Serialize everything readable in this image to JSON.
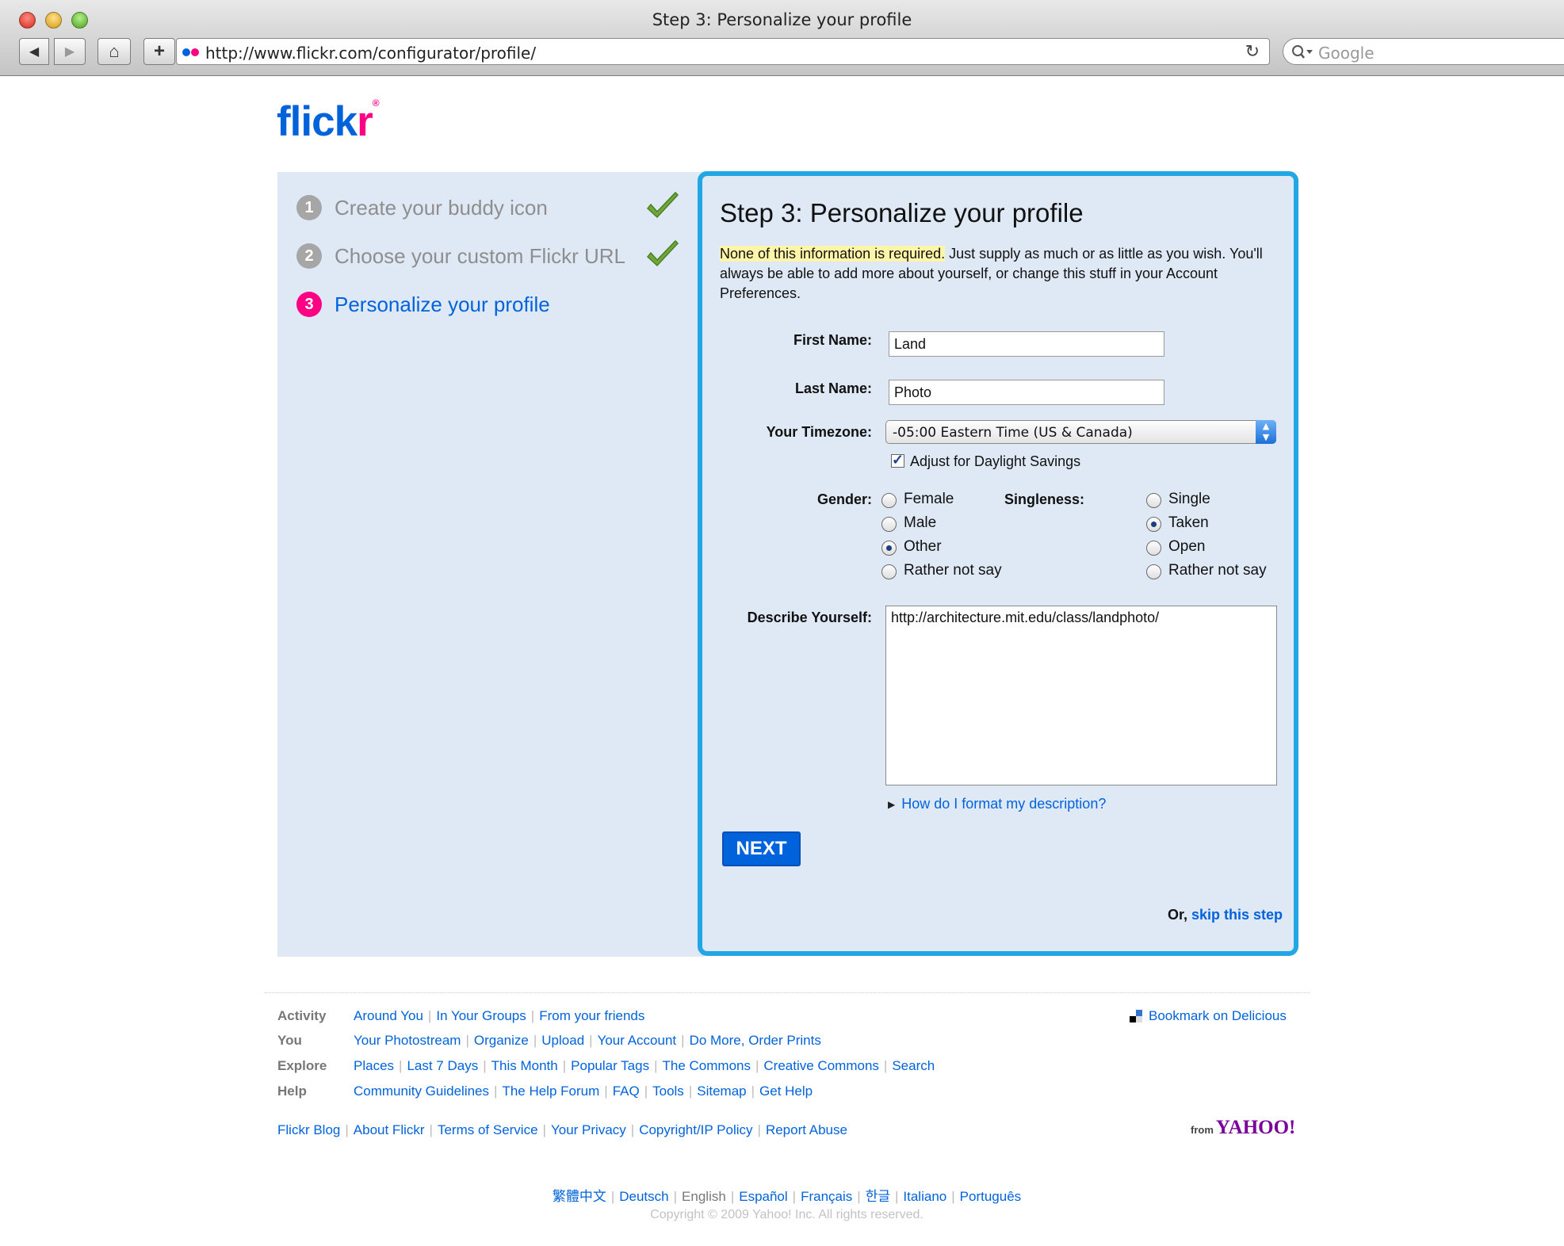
{
  "window": {
    "title": "Step 3: Personalize your profile"
  },
  "toolbar": {
    "url": "http://www.flickr.com/configurator/profile/",
    "search_placeholder": "Google"
  },
  "logo": {
    "text_main": "flick",
    "text_r": "r"
  },
  "steps": [
    {
      "num": "1",
      "label": "Create your buddy icon",
      "done": true
    },
    {
      "num": "2",
      "label": "Choose your custom Flickr URL",
      "done": true
    },
    {
      "num": "3",
      "label": "Personalize your profile",
      "done": false
    }
  ],
  "form": {
    "title": "Step 3: Personalize your profile",
    "intro_highlight": "None of this information is required.",
    "intro_rest": " Just supply as much or as little as you wish. You'll always be able to add more about yourself, or change this stuff in your Account Preferences.",
    "first_name_label": "First Name:",
    "first_name_value": "Land",
    "last_name_label": "Last Name:",
    "last_name_value": "Photo",
    "timezone_label": "Your Timezone:",
    "timezone_value": "-05:00 Eastern Time (US & Canada)",
    "dst_label": "Adjust for Daylight Savings",
    "dst_checked": true,
    "gender_label": "Gender:",
    "gender_options": [
      "Female",
      "Male",
      "Other",
      "Rather not say"
    ],
    "gender_selected": "Other",
    "singleness_label": "Singleness:",
    "singleness_options": [
      "Single",
      "Taken",
      "Open",
      "Rather not say"
    ],
    "singleness_selected": "Taken",
    "describe_label": "Describe Yourself:",
    "describe_value": "http://architecture.mit.edu/class/landphoto/",
    "format_link": "How do I format my description?",
    "next_label": "NEXT",
    "skip_prefix": "Or,",
    "skip_link": "skip this step"
  },
  "footer": {
    "rows": [
      {
        "cat": "Activity",
        "links": [
          "Around You",
          "In Your Groups",
          "From your friends"
        ]
      },
      {
        "cat": "You",
        "links": [
          "Your Photostream",
          "Organize",
          "Upload",
          "Your Account",
          "Do More, Order Prints"
        ]
      },
      {
        "cat": "Explore",
        "links": [
          "Places",
          "Last 7 Days",
          "This Month",
          "Popular Tags",
          "The Commons",
          "Creative Commons",
          "Search"
        ]
      },
      {
        "cat": "Help",
        "links": [
          "Community Guidelines",
          "The Help Forum",
          "FAQ",
          "Tools",
          "Sitemap",
          "Get Help"
        ]
      }
    ],
    "bottom_links": [
      "Flickr Blog",
      "About Flickr",
      "Terms of Service",
      "Your Privacy",
      "Copyright/IP Policy",
      "Report Abuse"
    ],
    "delicious": "Bookmark on Delicious",
    "yahoo_from": "from",
    "yahoo": "YAHOO!",
    "languages": [
      "繁體中文",
      "Deutsch",
      "English",
      "Español",
      "Français",
      "한글",
      "Italiano",
      "Português"
    ],
    "current_language": "English",
    "copyright": "Copyright © 2009 Yahoo! Inc. All rights reserved."
  }
}
